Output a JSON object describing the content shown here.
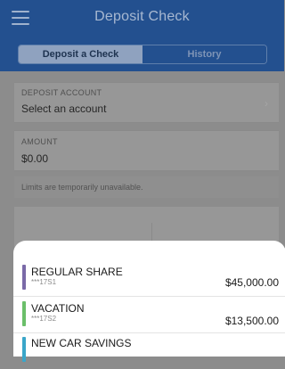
{
  "header": {
    "title": "Deposit Check",
    "tabs": [
      {
        "label": "Deposit a Check",
        "active": true
      },
      {
        "label": "History",
        "active": false
      }
    ]
  },
  "deposit_account": {
    "caption": "DEPOSIT ACCOUNT",
    "value": "Select an account"
  },
  "amount": {
    "caption": "AMOUNT",
    "value": "$0.00"
  },
  "limits_note": "Limits are temporarily unavailable.",
  "accounts": [
    {
      "name": "REGULAR SHARE",
      "mask": "***17S1",
      "balance": "$45,000.00",
      "color": "#7a6aa8"
    },
    {
      "name": "VACATION",
      "mask": "***17S2",
      "balance": "$13,500.00",
      "color": "#6bbf6a"
    },
    {
      "name": "NEW CAR SAVINGS",
      "mask": "",
      "balance": "",
      "color": "#3aa6c9"
    }
  ],
  "colors": {
    "header": "#23508f",
    "sheet": "#ffffff",
    "overlay": "#8c8c8c"
  },
  "icons": {
    "menu": "hamburger-menu-icon",
    "chevron": "chevron-right-icon"
  }
}
